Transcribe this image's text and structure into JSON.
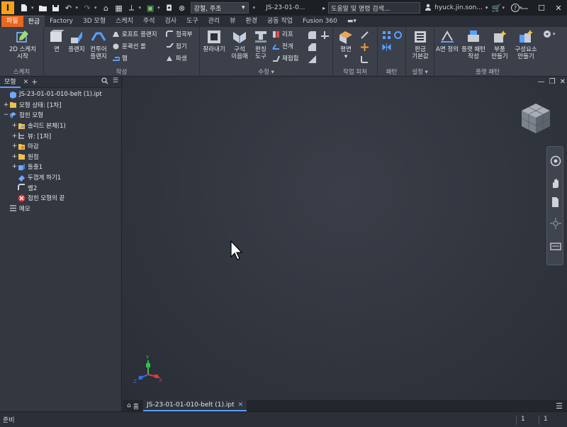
{
  "titlebar": {
    "app_letter": "I",
    "material": "강철, 주조",
    "document_title": "JS-23-01-0...",
    "search_placeholder": "도움말 및 명령 검색...",
    "user": "hyuck.jin.son...",
    "help": "?"
  },
  "ribbon_tabs": [
    {
      "label": "파일"
    },
    {
      "label": "판금"
    },
    {
      "label": "Factory"
    },
    {
      "label": "3D 모형"
    },
    {
      "label": "스케치"
    },
    {
      "label": "주석"
    },
    {
      "label": "검사"
    },
    {
      "label": "도구"
    },
    {
      "label": "관리"
    },
    {
      "label": "뷰"
    },
    {
      "label": "환경"
    },
    {
      "label": "공동 작업"
    },
    {
      "label": "Fusion 360"
    }
  ],
  "ribbon": {
    "groups": [
      {
        "label": "스케치"
      },
      {
        "label": "작성"
      },
      {
        "label": "수정"
      },
      {
        "label": "작업 피처"
      },
      {
        "label": "패턴"
      },
      {
        "label": "설정"
      },
      {
        "label": "플랫 패턴"
      }
    ],
    "sketch": {
      "start_2d_line1": "2D 스케치",
      "start_2d_line2": "시작"
    },
    "create": {
      "face": "면",
      "flange": "플랜지",
      "contour_flange_1": "컨투어",
      "contour_flange_2": "플랜지",
      "lofted_flange": "로프트 플랜지",
      "contour_roll": "윤곽선 롤",
      "hem": "헴",
      "bend": "절곡부",
      "fold": "접기",
      "derive": "파생"
    },
    "modify": {
      "cut": "잘라내기",
      "corner_1": "구석",
      "corner_2": "이음매",
      "punch_1": "펀칭",
      "punch_2": "도구",
      "rip": "리프",
      "unfold": "전개",
      "refold": "재접힘"
    },
    "work_features": {
      "plane": "평면"
    },
    "setup": {
      "defaults_1": "판금",
      "defaults_2": "기본값"
    },
    "flat_pattern": {
      "a_side": "A면 정의",
      "create_flat_1": "플랫 패턴",
      "create_flat_2": "작성",
      "make_part_1": "부품",
      "make_part_2": "만들기",
      "make_components_1": "구성요소",
      "make_components_2": "만들기"
    }
  },
  "browser": {
    "tab_label": "모형",
    "tree": [
      {
        "label": "JS-23-01-01-010-belt (1).ipt",
        "indent": 0,
        "expander": "",
        "icon": "part-icon"
      },
      {
        "label": "모형 상태: [1차]",
        "indent": 0,
        "expander": "+",
        "icon": "folder-icon"
      },
      {
        "label": "접힌 모형",
        "indent": 0,
        "expander": "−",
        "icon": "folded-model-icon"
      },
      {
        "label": "솔리드 본체(1)",
        "indent": 1,
        "expander": "+",
        "icon": "solid-bodies-icon"
      },
      {
        "label": "뷰: [1차]",
        "indent": 1,
        "expander": "+",
        "icon": "view-icon"
      },
      {
        "label": "마감",
        "indent": 1,
        "expander": "+",
        "icon": "finish-icon"
      },
      {
        "label": "원점",
        "indent": 1,
        "expander": "+",
        "icon": "folder-icon"
      },
      {
        "label": "돌출1",
        "indent": 1,
        "expander": "+",
        "icon": "extrude-icon"
      },
      {
        "label": "두껍게 하기1",
        "indent": 1,
        "expander": "",
        "icon": "thicken-icon"
      },
      {
        "label": "벨2",
        "indent": 1,
        "expander": "",
        "icon": "bend-icon"
      },
      {
        "label": "접힌 모형의 끝",
        "indent": 1,
        "expander": "",
        "icon": "end-of-part-icon"
      },
      {
        "label": "메모",
        "indent": 0,
        "expander": "",
        "icon": "notes-icon"
      }
    ]
  },
  "doc_tabs": {
    "home": "홈",
    "active_doc": "JS-23-01-01-010-belt (1).ipt"
  },
  "status": {
    "text": "준비",
    "count_a": "1",
    "count_b": "1"
  }
}
